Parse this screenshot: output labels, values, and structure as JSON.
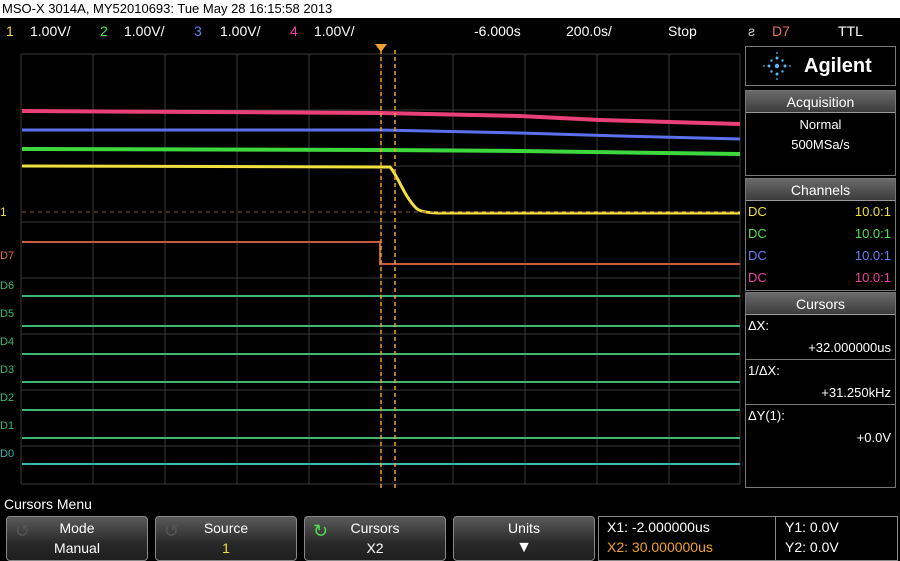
{
  "title": "MSO-X 3014A, MY52010693: Tue May 28 16:15:58 2013",
  "status": {
    "ch1": {
      "num": "1",
      "scale": "1.00V/",
      "color": "#f0e040"
    },
    "ch2": {
      "num": "2",
      "scale": "1.00V/",
      "color": "#4ee04e"
    },
    "ch3": {
      "num": "3",
      "scale": "1.00V/",
      "color": "#6c7cf0"
    },
    "ch4": {
      "num": "4",
      "scale": "1.00V/",
      "color": "#f040a0"
    },
    "delay": "-6.000s",
    "timebase": "200.0s/",
    "run_state": "Stop",
    "trigger_src": "D7",
    "trigger_level": "TTL"
  },
  "side": {
    "brand": "Agilent",
    "acquisition_title": "Acquisition",
    "acq_mode": "Normal",
    "acq_rate": "500MSa/s",
    "channels_title": "Channels",
    "channels": [
      {
        "coupling": "DC",
        "probe": "10.0:1",
        "color": "#f0e040"
      },
      {
        "coupling": "DC",
        "probe": "10.0:1",
        "color": "#4ee04e"
      },
      {
        "coupling": "DC",
        "probe": "10.0:1",
        "color": "#6c7cf0"
      },
      {
        "coupling": "DC",
        "probe": "10.0:1",
        "color": "#f040a0"
      }
    ],
    "cursors_title": "Cursors",
    "dx_label": "ΔX:",
    "dx_value": "+32.000000us",
    "inv_dx_label": "1/ΔX:",
    "inv_dx_value": "+31.250kHz",
    "dy_label": "ΔY(1):",
    "dy_value": "+0.0V"
  },
  "digital_labels": [
    "D7",
    "D6",
    "D5",
    "D4",
    "D3",
    "D2",
    "D1",
    "D0"
  ],
  "menu": {
    "title": "Cursors Menu",
    "keys": [
      {
        "title": "Mode",
        "value": "Manual"
      },
      {
        "title": "Source",
        "value": "1"
      },
      {
        "title": "Cursors",
        "value": "X2"
      },
      {
        "title": "Units",
        "value": ""
      }
    ],
    "readout": {
      "x1": "X1: -2.000000us",
      "x2": "X2: 30.000000us",
      "y1": "Y1: 0.0V",
      "y2": "Y2: 0.0V"
    }
  }
}
